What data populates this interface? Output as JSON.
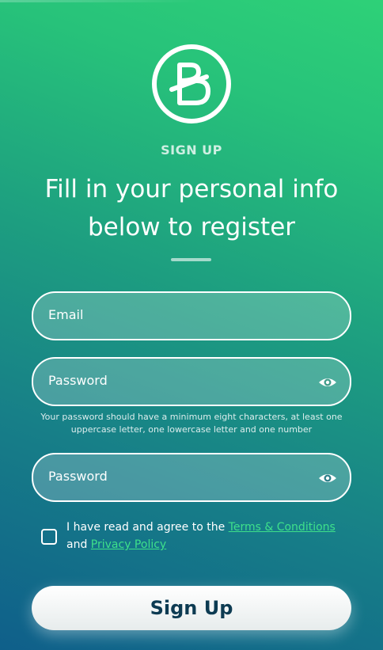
{
  "header": {
    "eyebrow": "SIGN UP",
    "title": "Fill in your personal info below to register"
  },
  "form": {
    "email_label": "Email",
    "password_label": "Password",
    "password_hint": "Your password should have a minimum eight characters, at least one uppercase letter, one lowercase letter and one number",
    "confirm_password_label": "Password",
    "agree_text": "I have read and agree to the",
    "terms_link": "Terms & Conditions",
    "and_text": "and",
    "privacy_link": "Privacy Policy",
    "submit_label": "Sign Up"
  },
  "icons": {
    "logo": "b-letter-logo",
    "password_toggle": "eye-icon"
  },
  "colors": {
    "gradient_top": "#2ed178",
    "gradient_bottom": "#0f5f8a",
    "link_green": "#3ee08a",
    "button_text": "#0d3b52"
  }
}
